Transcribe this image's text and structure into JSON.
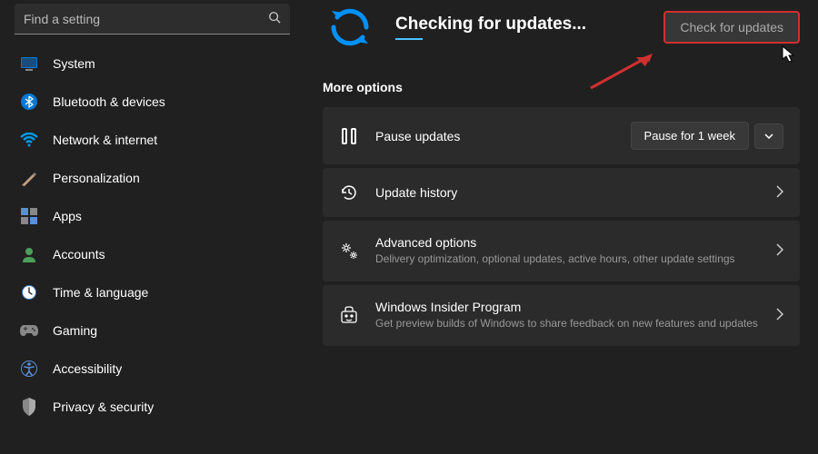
{
  "search": {
    "placeholder": "Find a setting"
  },
  "sidebar": {
    "items": [
      {
        "label": "System",
        "icon": "system"
      },
      {
        "label": "Bluetooth & devices",
        "icon": "bluetooth"
      },
      {
        "label": "Network & internet",
        "icon": "wifi"
      },
      {
        "label": "Personalization",
        "icon": "personalization"
      },
      {
        "label": "Apps",
        "icon": "apps"
      },
      {
        "label": "Accounts",
        "icon": "accounts"
      },
      {
        "label": "Time & language",
        "icon": "time"
      },
      {
        "label": "Gaming",
        "icon": "gaming"
      },
      {
        "label": "Accessibility",
        "icon": "accessibility"
      },
      {
        "label": "Privacy & security",
        "icon": "privacy"
      }
    ]
  },
  "main": {
    "status_title": "Checking for updates...",
    "check_button": "Check for updates",
    "more_options": "More options",
    "pause": {
      "title": "Pause updates",
      "dropdown": "Pause for 1 week"
    },
    "history": {
      "title": "Update history"
    },
    "advanced": {
      "title": "Advanced options",
      "sub": "Delivery optimization, optional updates, active hours, other update settings"
    },
    "insider": {
      "title": "Windows Insider Program",
      "sub": "Get preview builds of Windows to share feedback on new features and updates"
    }
  },
  "colors": {
    "accent": "#4cc2ff",
    "annotation": "#d03030"
  }
}
